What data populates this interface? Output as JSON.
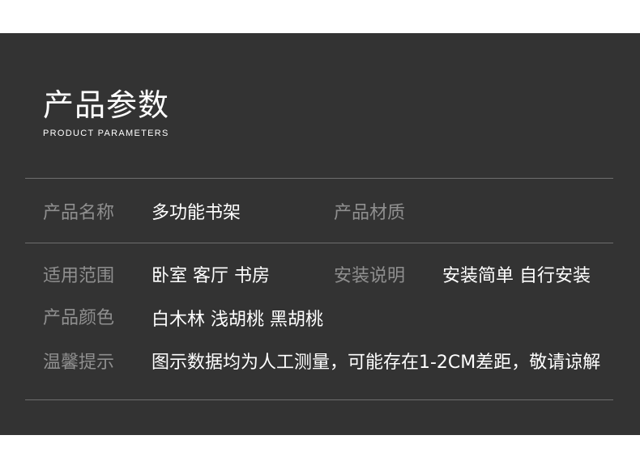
{
  "header": {
    "title": "产品参数",
    "subtitle": "PRODUCT PARAMETERS"
  },
  "params": {
    "name": {
      "label": "产品名称",
      "value": "多功能书架"
    },
    "material": {
      "label": "产品材质",
      "value": ""
    },
    "scope": {
      "label": "适用范围",
      "value": "卧室  客厅  书房"
    },
    "install": {
      "label": "安装说明",
      "value": "安装简单 自行安装"
    },
    "color": {
      "label": "产品颜色",
      "value": "白木林 浅胡桃 黑胡桃"
    },
    "tip": {
      "label": "温馨提示",
      "value": "图示数据均为人工测量，可能存在1-2CM差距，敬请谅解"
    }
  },
  "colors": {
    "panel_background": "#333333",
    "label_text": "#8f8f8f",
    "value_text": "#ffffff",
    "divider": "#6e6e6e"
  }
}
